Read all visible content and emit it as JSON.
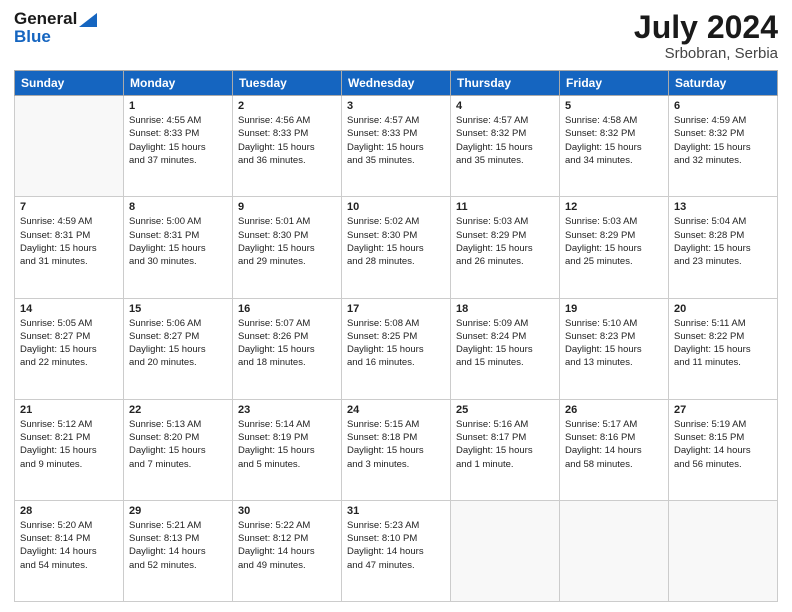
{
  "header": {
    "logo_line1": "General",
    "logo_line2": "Blue",
    "title": "July 2024",
    "location": "Srbobran, Serbia"
  },
  "weekdays": [
    "Sunday",
    "Monday",
    "Tuesday",
    "Wednesday",
    "Thursday",
    "Friday",
    "Saturday"
  ],
  "weeks": [
    [
      {
        "day": "",
        "info": ""
      },
      {
        "day": "1",
        "info": "Sunrise: 4:55 AM\nSunset: 8:33 PM\nDaylight: 15 hours\nand 37 minutes."
      },
      {
        "day": "2",
        "info": "Sunrise: 4:56 AM\nSunset: 8:33 PM\nDaylight: 15 hours\nand 36 minutes."
      },
      {
        "day": "3",
        "info": "Sunrise: 4:57 AM\nSunset: 8:33 PM\nDaylight: 15 hours\nand 35 minutes."
      },
      {
        "day": "4",
        "info": "Sunrise: 4:57 AM\nSunset: 8:32 PM\nDaylight: 15 hours\nand 35 minutes."
      },
      {
        "day": "5",
        "info": "Sunrise: 4:58 AM\nSunset: 8:32 PM\nDaylight: 15 hours\nand 34 minutes."
      },
      {
        "day": "6",
        "info": "Sunrise: 4:59 AM\nSunset: 8:32 PM\nDaylight: 15 hours\nand 32 minutes."
      }
    ],
    [
      {
        "day": "7",
        "info": "Sunrise: 4:59 AM\nSunset: 8:31 PM\nDaylight: 15 hours\nand 31 minutes."
      },
      {
        "day": "8",
        "info": "Sunrise: 5:00 AM\nSunset: 8:31 PM\nDaylight: 15 hours\nand 30 minutes."
      },
      {
        "day": "9",
        "info": "Sunrise: 5:01 AM\nSunset: 8:30 PM\nDaylight: 15 hours\nand 29 minutes."
      },
      {
        "day": "10",
        "info": "Sunrise: 5:02 AM\nSunset: 8:30 PM\nDaylight: 15 hours\nand 28 minutes."
      },
      {
        "day": "11",
        "info": "Sunrise: 5:03 AM\nSunset: 8:29 PM\nDaylight: 15 hours\nand 26 minutes."
      },
      {
        "day": "12",
        "info": "Sunrise: 5:03 AM\nSunset: 8:29 PM\nDaylight: 15 hours\nand 25 minutes."
      },
      {
        "day": "13",
        "info": "Sunrise: 5:04 AM\nSunset: 8:28 PM\nDaylight: 15 hours\nand 23 minutes."
      }
    ],
    [
      {
        "day": "14",
        "info": "Sunrise: 5:05 AM\nSunset: 8:27 PM\nDaylight: 15 hours\nand 22 minutes."
      },
      {
        "day": "15",
        "info": "Sunrise: 5:06 AM\nSunset: 8:27 PM\nDaylight: 15 hours\nand 20 minutes."
      },
      {
        "day": "16",
        "info": "Sunrise: 5:07 AM\nSunset: 8:26 PM\nDaylight: 15 hours\nand 18 minutes."
      },
      {
        "day": "17",
        "info": "Sunrise: 5:08 AM\nSunset: 8:25 PM\nDaylight: 15 hours\nand 16 minutes."
      },
      {
        "day": "18",
        "info": "Sunrise: 5:09 AM\nSunset: 8:24 PM\nDaylight: 15 hours\nand 15 minutes."
      },
      {
        "day": "19",
        "info": "Sunrise: 5:10 AM\nSunset: 8:23 PM\nDaylight: 15 hours\nand 13 minutes."
      },
      {
        "day": "20",
        "info": "Sunrise: 5:11 AM\nSunset: 8:22 PM\nDaylight: 15 hours\nand 11 minutes."
      }
    ],
    [
      {
        "day": "21",
        "info": "Sunrise: 5:12 AM\nSunset: 8:21 PM\nDaylight: 15 hours\nand 9 minutes."
      },
      {
        "day": "22",
        "info": "Sunrise: 5:13 AM\nSunset: 8:20 PM\nDaylight: 15 hours\nand 7 minutes."
      },
      {
        "day": "23",
        "info": "Sunrise: 5:14 AM\nSunset: 8:19 PM\nDaylight: 15 hours\nand 5 minutes."
      },
      {
        "day": "24",
        "info": "Sunrise: 5:15 AM\nSunset: 8:18 PM\nDaylight: 15 hours\nand 3 minutes."
      },
      {
        "day": "25",
        "info": "Sunrise: 5:16 AM\nSunset: 8:17 PM\nDaylight: 15 hours\nand 1 minute."
      },
      {
        "day": "26",
        "info": "Sunrise: 5:17 AM\nSunset: 8:16 PM\nDaylight: 14 hours\nand 58 minutes."
      },
      {
        "day": "27",
        "info": "Sunrise: 5:19 AM\nSunset: 8:15 PM\nDaylight: 14 hours\nand 56 minutes."
      }
    ],
    [
      {
        "day": "28",
        "info": "Sunrise: 5:20 AM\nSunset: 8:14 PM\nDaylight: 14 hours\nand 54 minutes."
      },
      {
        "day": "29",
        "info": "Sunrise: 5:21 AM\nSunset: 8:13 PM\nDaylight: 14 hours\nand 52 minutes."
      },
      {
        "day": "30",
        "info": "Sunrise: 5:22 AM\nSunset: 8:12 PM\nDaylight: 14 hours\nand 49 minutes."
      },
      {
        "day": "31",
        "info": "Sunrise: 5:23 AM\nSunset: 8:10 PM\nDaylight: 14 hours\nand 47 minutes."
      },
      {
        "day": "",
        "info": ""
      },
      {
        "day": "",
        "info": ""
      },
      {
        "day": "",
        "info": ""
      }
    ]
  ]
}
